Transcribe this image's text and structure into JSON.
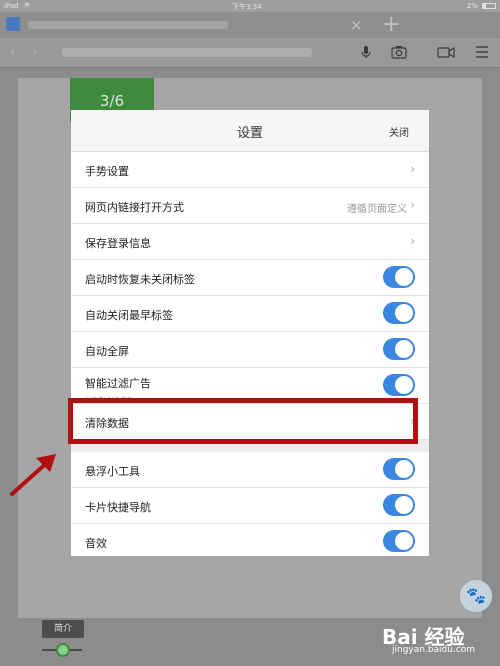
{
  "status_bar": {
    "device": "iPad",
    "time": "下午3:34",
    "battery": "2%"
  },
  "page": {
    "step_badge": "3/6",
    "intro_tag": "简介",
    "watermark": "Bai 经验",
    "watermark_url": "jingyan.baidu.com"
  },
  "settings": {
    "title": "设置",
    "close_label": "关闭",
    "rows": [
      {
        "label": "手势设置",
        "control": "chevron"
      },
      {
        "label": "网页内链接打开方式",
        "value": "遵循页面定义",
        "control": "chevron"
      },
      {
        "label": "保存登录信息",
        "control": "chevron"
      },
      {
        "label": "启动时恢复未关闭标签",
        "control": "toggle",
        "on": true
      },
      {
        "label": "自动关闭最早标签",
        "control": "toggle",
        "on": true
      },
      {
        "label": "自动全屏",
        "control": "toggle",
        "on": true
      },
      {
        "label": "智能过滤广告",
        "sublabel": "共过滤176条广告",
        "control": "toggle",
        "on": true
      },
      {
        "label": "清除数据",
        "control": "chevron"
      },
      {
        "label": "悬浮小工具",
        "control": "toggle",
        "on": true
      },
      {
        "label": "卡片快捷导航",
        "control": "toggle",
        "on": true
      },
      {
        "label": "音效",
        "control": "toggle",
        "on": true
      }
    ]
  },
  "colors": {
    "toggle_on": "#3a86e0",
    "highlight": "#b01010",
    "step_badge": "#3e8b3e"
  }
}
